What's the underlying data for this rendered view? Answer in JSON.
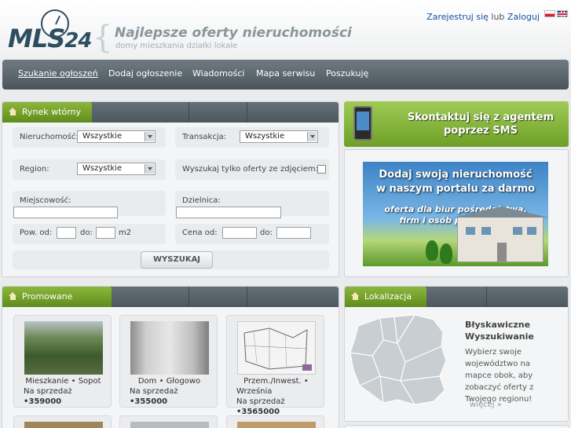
{
  "header": {
    "logo_text": "MLS",
    "logo_num": "24",
    "tagline": "Najlepsze oferty nieruchomości",
    "subtagline": "domy mieszkania działki lokale",
    "register_link": "Zarejestruj się",
    "or_text": " lub ",
    "login_link": "Zaloguj"
  },
  "nav": {
    "items": [
      "Szukanie ogłoszeń",
      "Dodaj ogłoszenie",
      "Wiadomości",
      "Mapa serwisu",
      "Poszukuję"
    ]
  },
  "search": {
    "tab_label": "Rynek wtórny",
    "property_label": "Nieruchomość:",
    "property_value": "Wszystkie",
    "transaction_label": "Transakcja:",
    "transaction_value": "Wszystkie",
    "region_label": "Region:",
    "region_value": "Wszystkie",
    "photo_only_label": "Wyszukaj tylko oferty ze zdjęciem:",
    "city_label": "Miejscowość:",
    "district_label": "Dzielnica:",
    "area_from_label": "Pow. od:",
    "area_to_label": "do:",
    "area_unit": "m2",
    "price_from_label": "Cena od:",
    "price_to_label": "do:",
    "submit_label": "WYSZUKAJ"
  },
  "ads": {
    "sms_line1": "Skontaktuj się z agentem",
    "sms_line2": "poprzez SMS",
    "free_line1": "Dodaj swoją nieruchomość",
    "free_line2": "w naszym portalu za darmo",
    "free_line3": "oferta dla biur pośrednictwa,",
    "free_line4": "firm i osób prywatnych"
  },
  "promoted": {
    "tab_label": "Promowane oferty",
    "offers": [
      {
        "line1": "Mieszkanie • Sopot",
        "line2": "Na sprzedaż",
        "price": "•359000"
      },
      {
        "line1": "Dom • Głogowo",
        "line2": "Na sprzedaż",
        "price": "•355000"
      },
      {
        "line1": "Przem./Inwest. •",
        "line1b": "Września",
        "line2": "Na sprzedaż",
        "price": "•3565000"
      }
    ]
  },
  "location": {
    "tab_label": "Lokalizacja",
    "title_line1": "Błyskawiczne",
    "title_line2": "Wyszukiwanie",
    "description": "Wybierz swoje województwo na mapce obok, aby zobaczyć oferty z Twojego regionu!",
    "more_link": "więcej »"
  },
  "colors": {
    "accent_green": "#7aa72e",
    "nav_gray": "#5c666d",
    "link_blue": "#1d4fa3"
  }
}
